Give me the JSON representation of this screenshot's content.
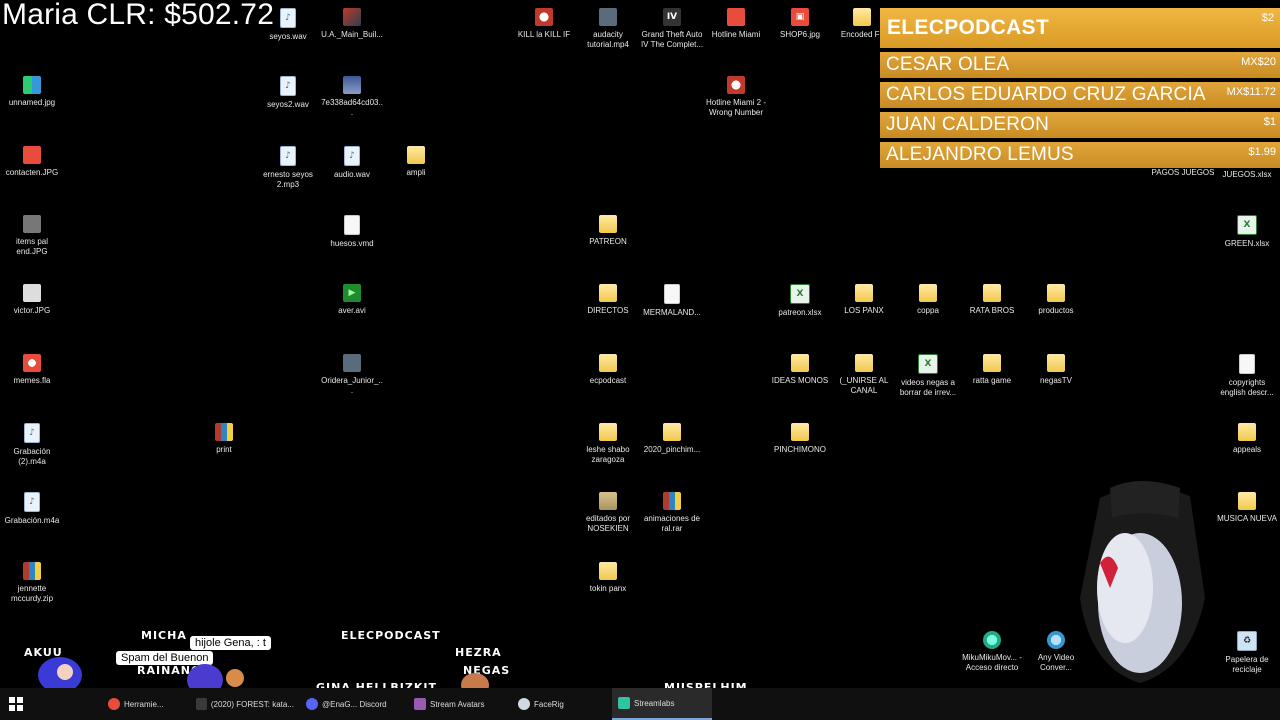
{
  "overlay": {
    "cash_text": "Maria CLR: $502.72",
    "donations_title": "ELECPODCAST",
    "donations_title_amount": "$2",
    "donations": [
      {
        "name": "CESAR OLEA",
        "amount": "MX$20"
      },
      {
        "name": "CARLOS EDUARDO CRUZ GARCIA",
        "amount": "MX$11.72"
      },
      {
        "name": "JUAN CALDERON",
        "amount": "$1"
      },
      {
        "name": "ALEJANDRO LEMUS",
        "amount": "$1.99"
      }
    ],
    "chat_names": [
      "AKUU",
      "MICHA",
      "ELECPODCAST",
      "HEZRA",
      "NEGAS",
      "GINA HELLBIZKIT",
      "MUSPELHIM",
      "RAINANO"
    ],
    "bubbles": [
      "hijole Gena, : t",
      "Spam del Buenon"
    ]
  },
  "desktop": {
    "icons": [
      {
        "label": "seyos.wav",
        "type": "audio"
      },
      {
        "label": "U.A._Main_Buil...",
        "type": "img"
      },
      {
        "label": "KILL la KILL IF",
        "type": "app"
      },
      {
        "label": "audacity tutorial.mp4",
        "type": "vid"
      },
      {
        "label": "Grand Theft Auto IV The Complet...",
        "type": "app"
      },
      {
        "label": "Hotline Miami",
        "type": "app"
      },
      {
        "label": "SHOP6.jpg",
        "type": "shop"
      },
      {
        "label": "Encoded Fil",
        "type": "folder"
      },
      {
        "label": "unnamed.jpg",
        "type": "img"
      },
      {
        "label": "seyos2.wav",
        "type": "audio"
      },
      {
        "label": "7e338ad64cd03...",
        "type": "img"
      },
      {
        "label": "Hotline Miami 2 - Wrong Number",
        "type": "app"
      },
      {
        "label": "contacten.JPG",
        "type": "img"
      },
      {
        "label": "ernesto seyos 2.mp3",
        "type": "audio"
      },
      {
        "label": "audio.wav",
        "type": "audio"
      },
      {
        "label": "ampli",
        "type": "folder"
      },
      {
        "label": "PAGOS JUEGOS",
        "type": "folder"
      },
      {
        "label": "JUEGOS.xlsx",
        "type": "xls"
      },
      {
        "label": "items pal end.JPG",
        "type": "img"
      },
      {
        "label": "huesos.vmd",
        "type": "doc"
      },
      {
        "label": "PATREON",
        "type": "folder"
      },
      {
        "label": "GREEN.xlsx",
        "type": "xls"
      },
      {
        "label": "victor.JPG",
        "type": "img"
      },
      {
        "label": "aver.avi",
        "type": "green"
      },
      {
        "label": "DIRECTOS",
        "type": "folder"
      },
      {
        "label": "MERMALAND...",
        "type": "doc"
      },
      {
        "label": "patreon.xlsx",
        "type": "xls"
      },
      {
        "label": "LOS PANX",
        "type": "folder"
      },
      {
        "label": "coppa",
        "type": "folder"
      },
      {
        "label": "RATA BROS",
        "type": "folder"
      },
      {
        "label": "productos",
        "type": "folder"
      },
      {
        "label": "memes.fla",
        "type": "img"
      },
      {
        "label": "Oridera_Junior_...",
        "type": "vid"
      },
      {
        "label": "ecpodcast",
        "type": "folder"
      },
      {
        "label": "IDEAS MONOS",
        "type": "folder"
      },
      {
        "label": "(_UNIRSE AL CANAL",
        "type": "folder"
      },
      {
        "label": "videos negas a borrar de irrev...",
        "type": "xls"
      },
      {
        "label": "ratta game",
        "type": "folder"
      },
      {
        "label": "negasTV",
        "type": "folder"
      },
      {
        "label": "copyrights english descr...",
        "type": "doc"
      },
      {
        "label": "Grabación (2).m4a",
        "type": "audio"
      },
      {
        "label": "print",
        "type": "zip"
      },
      {
        "label": "leshe shabo zaragoza",
        "type": "folder"
      },
      {
        "label": "2020_pinchim...",
        "type": "folder"
      },
      {
        "label": "PINCHIMONO",
        "type": "folder"
      },
      {
        "label": "appeals",
        "type": "folder"
      },
      {
        "label": "Grabación.m4a",
        "type": "audio"
      },
      {
        "label": "editados por NOSEKIEN",
        "type": "folder"
      },
      {
        "label": "animaciones de ral.rar",
        "type": "zip"
      },
      {
        "label": "MUSICA NUEVA",
        "type": "folder"
      },
      {
        "label": "jennette mccurdy.zip",
        "type": "zip"
      },
      {
        "label": "tokin panx",
        "type": "folder"
      },
      {
        "label": "MikuMikuMov... - Acceso directo",
        "type": "app"
      },
      {
        "label": "Any Video Conver...",
        "type": "app"
      },
      {
        "label": "Papelera de reciclaje",
        "type": "doc"
      }
    ]
  },
  "taskbar": {
    "items": [
      {
        "label": "Herramie...",
        "active": false
      },
      {
        "label": "(2020) FOREST: kata...",
        "active": false
      },
      {
        "label": "@EnaG... Discord",
        "active": false
      },
      {
        "label": "Stream Avatars",
        "active": false
      },
      {
        "label": "FaceRig",
        "active": false
      },
      {
        "label": "Streamlabs",
        "active": true
      }
    ]
  },
  "colors": {
    "donation_bar": "#d89a25",
    "desktop_bg": "#000000",
    "taskbar_bg": "#101010"
  }
}
